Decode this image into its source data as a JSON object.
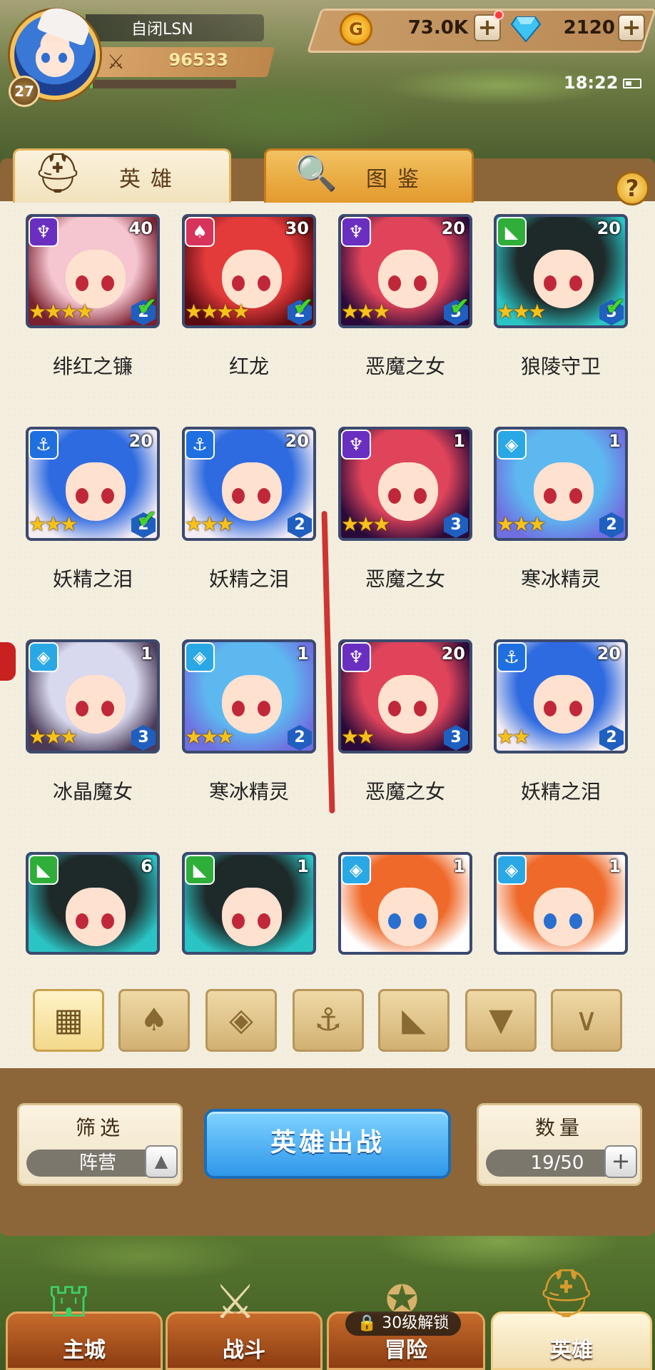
{
  "player": {
    "name": "自闭LSN",
    "level": "27",
    "power": "96533",
    "exp_fraction": 0.02
  },
  "resources": {
    "gold": "73.0K",
    "gems": "2120",
    "gold_icon": "G",
    "gem_icon": "diamond-icon"
  },
  "status_bar": {
    "time": "18:22"
  },
  "tabs": [
    {
      "label": "英雄",
      "icon": "helmet-icon"
    },
    {
      "label": "图鉴",
      "icon": "magnifier-book-icon"
    }
  ],
  "help_label": "?",
  "heroes": [
    {
      "name": "绯红之镰",
      "level": "40",
      "stars": 4,
      "rank": "2",
      "faction": "demon",
      "deployed": true
    },
    {
      "name": "红龙",
      "level": "30",
      "stars": 4,
      "rank": "2",
      "faction": "flame",
      "deployed": true
    },
    {
      "name": "恶魔之女",
      "level": "20",
      "stars": 3,
      "rank": "3",
      "faction": "demon",
      "deployed": true
    },
    {
      "name": "狼陵守卫",
      "level": "20",
      "stars": 3,
      "rank": "3",
      "faction": "beast",
      "deployed": true
    },
    {
      "name": "妖精之泪",
      "level": "20",
      "stars": 3,
      "rank": "2",
      "faction": "anchor",
      "deployed": true
    },
    {
      "name": "妖精之泪",
      "level": "20",
      "stars": 3,
      "rank": "2",
      "faction": "anchor",
      "deployed": false
    },
    {
      "name": "恶魔之女",
      "level": "1",
      "stars": 3,
      "rank": "3",
      "faction": "demon",
      "deployed": false
    },
    {
      "name": "寒冰精灵",
      "level": "1",
      "stars": 3,
      "rank": "2",
      "faction": "ice",
      "deployed": false
    },
    {
      "name": "冰晶魔女",
      "level": "1",
      "stars": 3,
      "rank": "3",
      "faction": "ice",
      "deployed": false
    },
    {
      "name": "寒冰精灵",
      "level": "1",
      "stars": 3,
      "rank": "2",
      "faction": "ice",
      "deployed": false
    },
    {
      "name": "恶魔之女",
      "level": "20",
      "stars": 2,
      "rank": "3",
      "faction": "demon",
      "deployed": false
    },
    {
      "name": "妖精之泪",
      "level": "20",
      "stars": 2,
      "rank": "2",
      "faction": "anchor",
      "deployed": false
    },
    {
      "name": "",
      "level": "6",
      "stars": 0,
      "rank": "",
      "faction": "beast",
      "deployed": false
    },
    {
      "name": "",
      "level": "1",
      "stars": 0,
      "rank": "",
      "faction": "beast",
      "deployed": false
    },
    {
      "name": "",
      "level": "1",
      "stars": 0,
      "rank": "",
      "faction": "ice",
      "deployed": false
    },
    {
      "name": "",
      "level": "1",
      "stars": 0,
      "rank": "",
      "faction": "ice",
      "deployed": false
    }
  ],
  "faction_filters": [
    {
      "name": "all",
      "icon": "grid-icon",
      "glyph": "▦",
      "active": true
    },
    {
      "name": "flame",
      "icon": "flame-icon",
      "glyph": "♠",
      "active": false
    },
    {
      "name": "ice",
      "icon": "diamond-rune-icon",
      "glyph": "◈",
      "active": false
    },
    {
      "name": "anchor",
      "icon": "anchor-icon",
      "glyph": "⚓",
      "active": false
    },
    {
      "name": "beast",
      "icon": "beast-head-icon",
      "glyph": "◣",
      "active": false
    },
    {
      "name": "demon",
      "icon": "demon-horns-icon",
      "glyph": "▼",
      "active": false
    },
    {
      "name": "dark",
      "icon": "wings-icon",
      "glyph": "∨",
      "active": false
    }
  ],
  "bottom": {
    "filter_title": "筛选",
    "filter_value": "阵营",
    "deploy_label": "英雄出战",
    "count_title": "数量",
    "count_value": "19/50"
  },
  "nav": [
    {
      "label": "主城",
      "icon": "castle-icon",
      "active": false
    },
    {
      "label": "战斗",
      "icon": "crossed-swords-icon",
      "active": false
    },
    {
      "label": "冒险",
      "icon": "treasure-icon",
      "active": false,
      "lock": "30级解锁"
    },
    {
      "label": "英雄",
      "icon": "hero-helmet-icon",
      "active": true
    }
  ],
  "colors": {
    "demon": "#6a2fc0",
    "flame": "#d8335a",
    "beast": "#2fae3a",
    "anchor": "#1f6fe0",
    "ice": "#2aa8e6",
    "deploy_button": "#2f97ea"
  }
}
